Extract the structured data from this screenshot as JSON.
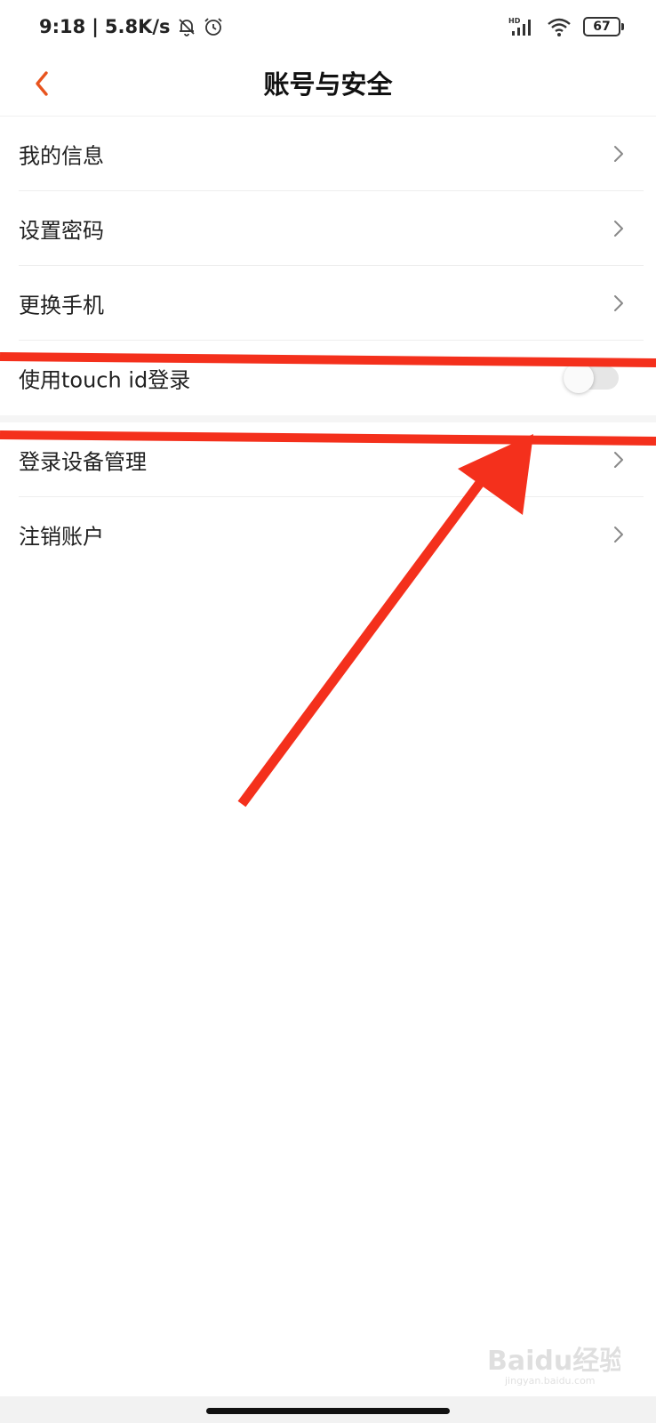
{
  "status_bar": {
    "time": "9:18",
    "separator": "|",
    "network_speed": "5.8K/s",
    "icons": [
      "bell-muted-icon",
      "alarm-icon",
      "hd-signal-icon",
      "wifi-icon",
      "battery-icon"
    ],
    "signal_label": "HD",
    "battery_level": "67"
  },
  "header": {
    "title": "账号与安全",
    "back_icon": "chevron-left-icon",
    "accent_color": "#e8541e"
  },
  "menu": {
    "items": [
      {
        "label": "我的信息",
        "control": "chevron-right-icon"
      },
      {
        "label": "设置密码",
        "control": "chevron-right-icon"
      },
      {
        "label": "更换手机",
        "control": "chevron-right-icon"
      },
      {
        "label": "使用touch id登录",
        "control": "toggle",
        "toggle_on": false
      },
      {
        "label": "登录设备管理",
        "control": "chevron-right-icon"
      },
      {
        "label": "注销账户",
        "control": "chevron-right-icon"
      }
    ]
  },
  "annotation": {
    "color": "#f4301c",
    "shapes": [
      "highlight-line",
      "highlight-line",
      "arrow"
    ]
  },
  "watermark": {
    "text": "Baidu经验",
    "subtext": "jingyan.baidu.com"
  }
}
